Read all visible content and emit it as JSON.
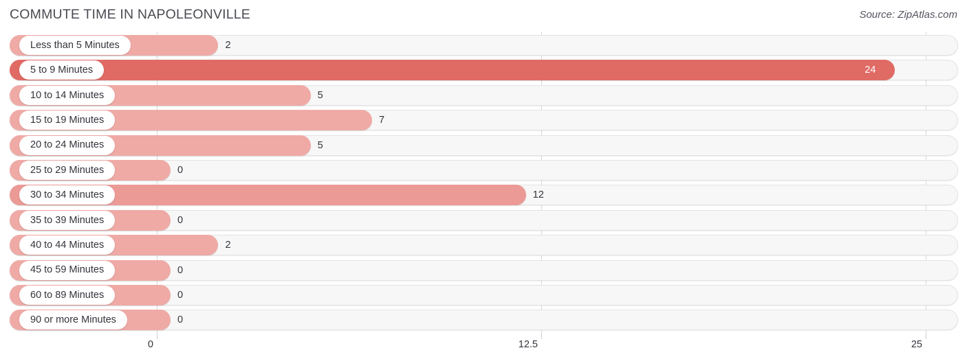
{
  "header": {
    "title": "COMMUTE TIME IN NAPOLEONVILLE",
    "source": "Source: ZipAtlas.com"
  },
  "colors": {
    "bar_default": "#efaaa6",
    "bar_mid": "#eb9a96",
    "bar_high": "#e8837e",
    "bar_max": "#e06a64",
    "track_bg": "#f7f7f7",
    "track_border": "#e3e3e3",
    "gridline": "#d8d8d8",
    "text": "#33333b",
    "title_text": "#4a4a52"
  },
  "chart_data": {
    "type": "bar",
    "orientation": "horizontal",
    "title": "COMMUTE TIME IN NAPOLEONVILLE",
    "xlabel": "",
    "ylabel": "",
    "xlim": [
      0,
      25
    ],
    "grid": true,
    "legend": null,
    "axis_ticks": [
      "0",
      "12.5",
      "25"
    ],
    "axis_tick_values": [
      0,
      12.5,
      25
    ],
    "categories": [
      "Less than 5 Minutes",
      "5 to 9 Minutes",
      "10 to 14 Minutes",
      "15 to 19 Minutes",
      "20 to 24 Minutes",
      "25 to 29 Minutes",
      "30 to 34 Minutes",
      "35 to 39 Minutes",
      "40 to 44 Minutes",
      "45 to 59 Minutes",
      "60 to 89 Minutes",
      "90 or more Minutes"
    ],
    "values": [
      2,
      24,
      5,
      7,
      5,
      0,
      12,
      0,
      2,
      0,
      0,
      0
    ],
    "value_labels": [
      "2",
      "24",
      "5",
      "7",
      "5",
      "0",
      "12",
      "0",
      "2",
      "0",
      "0",
      "0"
    ]
  }
}
